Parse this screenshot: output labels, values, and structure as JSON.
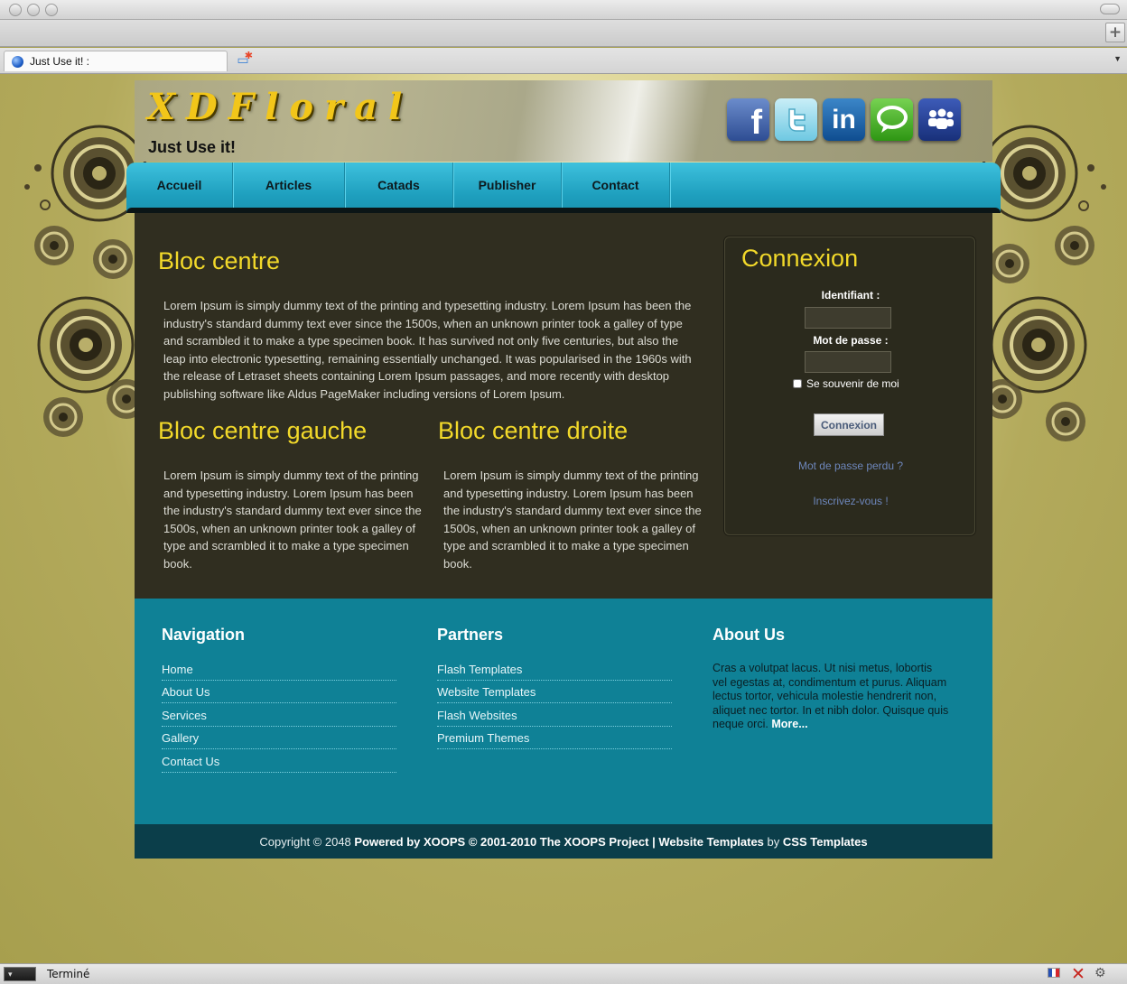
{
  "browser": {
    "tab_title": "Just Use it! :",
    "status_text": "Terminé",
    "plus_label": "+"
  },
  "site": {
    "logo": "XDFloral",
    "slogan": "Just Use it!",
    "social": [
      "facebook-icon",
      "twitter-icon",
      "linkedin-icon",
      "chat-icon",
      "myspace-icon"
    ],
    "nav": [
      "Accueil",
      "Articles",
      "Catads",
      "Publisher",
      "Contact"
    ],
    "content": {
      "center_title": "Bloc centre",
      "center_text": "Lorem Ipsum is simply dummy text of the printing and typesetting industry. Lorem Ipsum has been the industry's standard dummy text ever since the 1500s, when an unknown printer took a galley of type and scrambled it to make a type specimen book. It has survived not only five centuries, but also the leap into electronic typesetting, remaining essentially unchanged. It was popularised in the 1960s with the release of Letraset sheets containing Lorem Ipsum passages, and more recently with desktop publishing software like Aldus PageMaker including versions of Lorem Ipsum.",
      "left_title": "Bloc centre gauche",
      "left_text": "Lorem Ipsum is simply dummy text of the printing and typesetting industry. Lorem Ipsum has been the industry's standard dummy text ever since the 1500s, when an unknown printer took a galley of type and scrambled it to make a type specimen book.",
      "right_title": "Bloc centre droite",
      "right_text": "Lorem Ipsum is simply dummy text of the printing and typesetting industry. Lorem Ipsum has been the industry's standard dummy text ever since the 1500s, when an unknown printer took a galley of type and scrambled it to make a type specimen book."
    },
    "login": {
      "title": "Connexion",
      "username_label": "Identifiant :",
      "password_label": "Mot de passe :",
      "remember_label": "Se souvenir de moi",
      "button": "Connexion",
      "lost_password": "Mot de passe perdu ?",
      "register": "Inscrivez-vous !"
    },
    "footer": {
      "navigation_title": "Navigation",
      "navigation": [
        "Home",
        "About Us",
        "Services",
        "Gallery",
        "Contact Us"
      ],
      "partners_title": "Partners",
      "partners": [
        "Flash Templates",
        "Website Templates",
        "Flash Websites",
        "Premium Themes"
      ],
      "about_title": "About Us",
      "about_text": "Cras a volutpat lacus. Ut nisi metus, lobortis vel egestas at, condimentum et purus. Aliquam lectus tortor, vehicula molestie hendrerit non, aliquet nec tortor. In et nibh dolor. Quisque quis neque orci.",
      "about_more": "More..."
    },
    "copyright": {
      "prefix": "Copyright © 2048",
      "powered": "Powered by XOOPS © 2001-2010 The XOOPS Project",
      "sep": "|",
      "templates": "Website Templates",
      "by": "by",
      "css": "CSS Templates"
    }
  }
}
